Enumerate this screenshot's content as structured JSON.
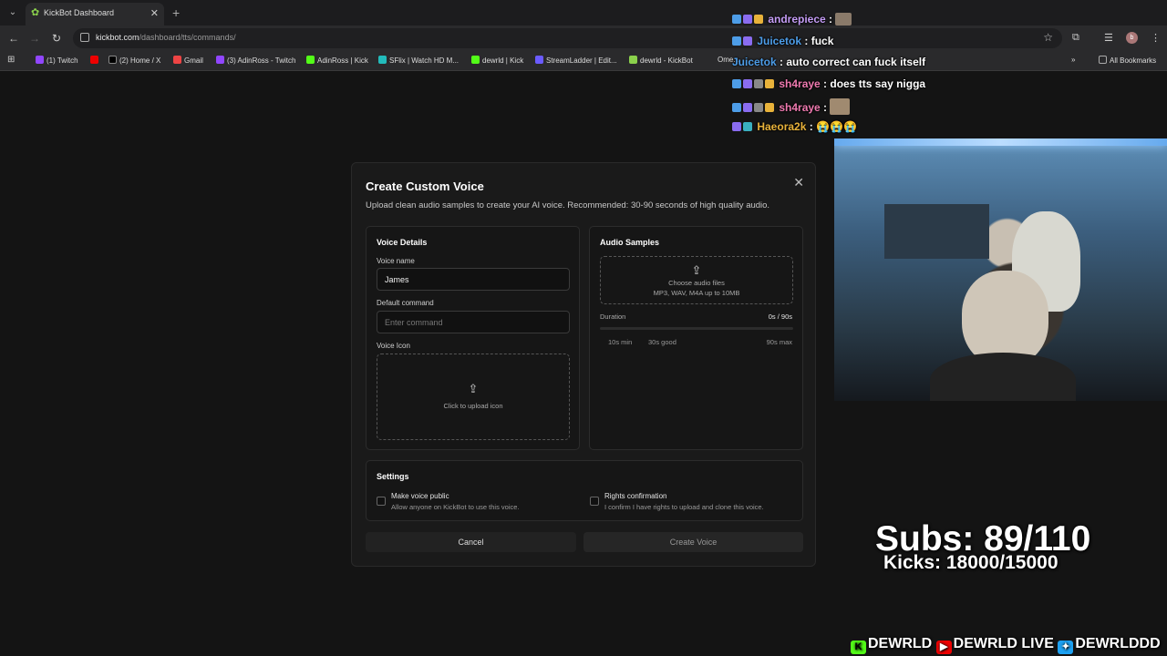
{
  "browser": {
    "tab_title": "KickBot Dashboard",
    "url_host": "kickbot.com",
    "url_path": "/dashboard/tts/commands/",
    "profile_initial": "b",
    "bookmarks": [
      "(1) Twitch",
      "(2) Home / X",
      "Gmail",
      "(3) AdinRoss - Twitch",
      "AdinRoss | Kick",
      "SFlix | Watch HD M...",
      "dewrld | Kick",
      "StreamLadder | Edit...",
      "dewrld - KickBot",
      "Ome...",
      "All Bookmarks"
    ]
  },
  "chat": [
    {
      "user": "andrepiece",
      "msg": "",
      "color": "#c49cf5"
    },
    {
      "user": "Juicetok",
      "msg": "fuck",
      "color": "#4d9de8"
    },
    {
      "user": "Juicetok",
      "msg": "auto correct can fuck itself",
      "color": "#4d9de8"
    },
    {
      "user": "sh4raye",
      "msg": "does tts say nigga",
      "color": "#f07ab0"
    },
    {
      "user": "sh4raye",
      "msg": "",
      "color": "#f07ab0"
    },
    {
      "user": "Haeora2k",
      "msg": "😭😭😭",
      "color": "#e8b23a"
    }
  ],
  "modal": {
    "title": "Create Custom Voice",
    "subtitle": "Upload clean audio samples to create your AI voice. Recommended: 30-90 seconds of high quality audio.",
    "voice_details": {
      "heading": "Voice Details",
      "name_label": "Voice name",
      "name_value": "James",
      "command_label": "Default command",
      "command_placeholder": "Enter command",
      "icon_label": "Voice Icon",
      "icon_upload_text": "Click to upload icon"
    },
    "audio_samples": {
      "heading": "Audio Samples",
      "choose_text": "Choose audio files",
      "formats_text": "MP3, WAV, M4A up to 10MB",
      "duration_label": "Duration",
      "duration_value": "0s / 90s",
      "mark_min": "10s min",
      "mark_good": "30s good",
      "mark_max": "90s max"
    },
    "settings": {
      "heading": "Settings",
      "public_title": "Make voice public",
      "public_desc": "Allow anyone on KickBot to use this voice.",
      "rights_title": "Rights confirmation",
      "rights_desc": "I confirm I have rights to upload and clone this voice."
    },
    "cancel_label": "Cancel",
    "create_label": "Create Voice"
  },
  "overlay": {
    "subs": "Subs: 89/110",
    "kicks": "Kicks: 18000/15000",
    "social_1": "DEWRLD",
    "social_2": "DEWRLD LIVE",
    "social_3": "DEWRLDDD"
  }
}
